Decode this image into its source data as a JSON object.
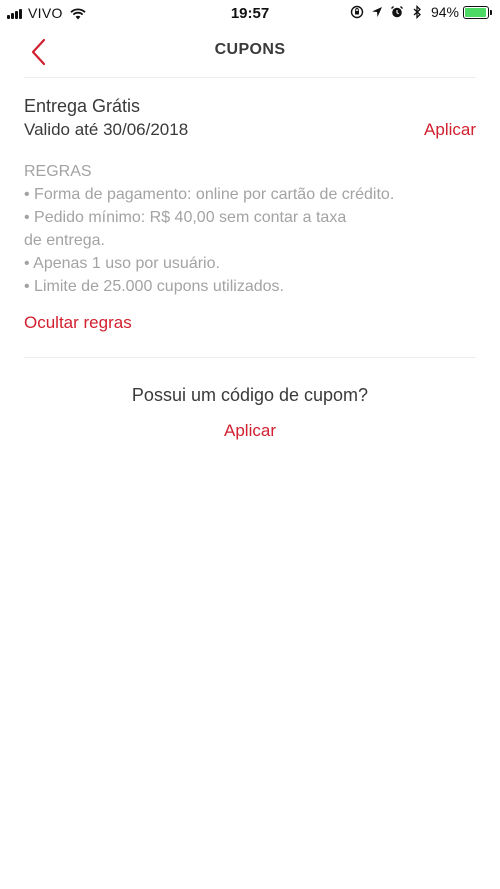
{
  "status_bar": {
    "carrier": "VIVO",
    "time": "19:57",
    "battery_percent": "94%",
    "battery_level": 0.94,
    "battery_color": "#4cd964",
    "icons": [
      "signal-icon",
      "wifi-icon",
      "screen-lock-icon",
      "location-icon",
      "alarm-icon",
      "bluetooth-icon",
      "battery-icon"
    ]
  },
  "nav": {
    "title": "CUPONS",
    "back_icon": "chevron-left-icon"
  },
  "coupon": {
    "title": "Entrega Grátis",
    "validity": "Valido até 30/06/2018",
    "apply_label": "Aplicar",
    "rules_heading": "REGRAS",
    "rules": [
      "• Forma de pagamento: online por cartão de crédito.",
      "• Pedido mínimo: R$ 40,00 sem contar a taxa",
      "de entrega.",
      "• Apenas 1 uso por usuário.",
      "• Limite de 25.000 cupons utilizados."
    ],
    "hide_rules_label": "Ocultar regras"
  },
  "promo": {
    "question": "Possui um código de cupom?",
    "apply_label": "Aplicar"
  },
  "colors": {
    "accent": "#d1202f",
    "text": "#3a3a3a",
    "muted": "#a3a3a3",
    "divider": "#ececec"
  }
}
